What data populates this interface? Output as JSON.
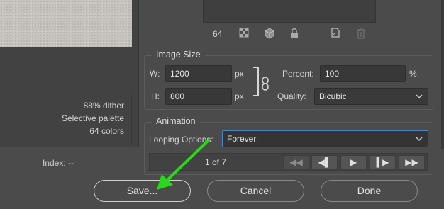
{
  "preview": {
    "info_lines": [
      "88% dither",
      "Selective palette",
      "64 colors"
    ],
    "index_label": "Index: --"
  },
  "color_table": {
    "count": "64",
    "icons": [
      "transparency-icon",
      "web-snap-icon",
      "lock-icon",
      "new-color-icon",
      "delete-icon"
    ]
  },
  "image_size": {
    "title": "Image Size",
    "w_label": "W:",
    "w_value": "1200",
    "h_label": "H:",
    "h_value": "800",
    "unit": "px",
    "percent_label": "Percent:",
    "percent_value": "100",
    "percent_unit": "%",
    "quality_label": "Quality:",
    "quality_value": "Bicubic"
  },
  "animation": {
    "title": "Animation",
    "looping_label": "Looping Options:",
    "looping_value": "Forever",
    "frame_count": "1 of 7"
  },
  "nav_buttons": [
    {
      "glyph": "◀◀"
    },
    {
      "glyph": "◀▌"
    },
    {
      "glyph": "▶"
    },
    {
      "glyph": "▌▶"
    },
    {
      "glyph": "▶▶"
    }
  ],
  "buttons": {
    "save": "Save...",
    "cancel": "Cancel",
    "done": "Done"
  },
  "colors": {
    "background": "#4b4b4b",
    "focus_border": "#4a86c8",
    "annotation_arrow": "#22dd11"
  }
}
